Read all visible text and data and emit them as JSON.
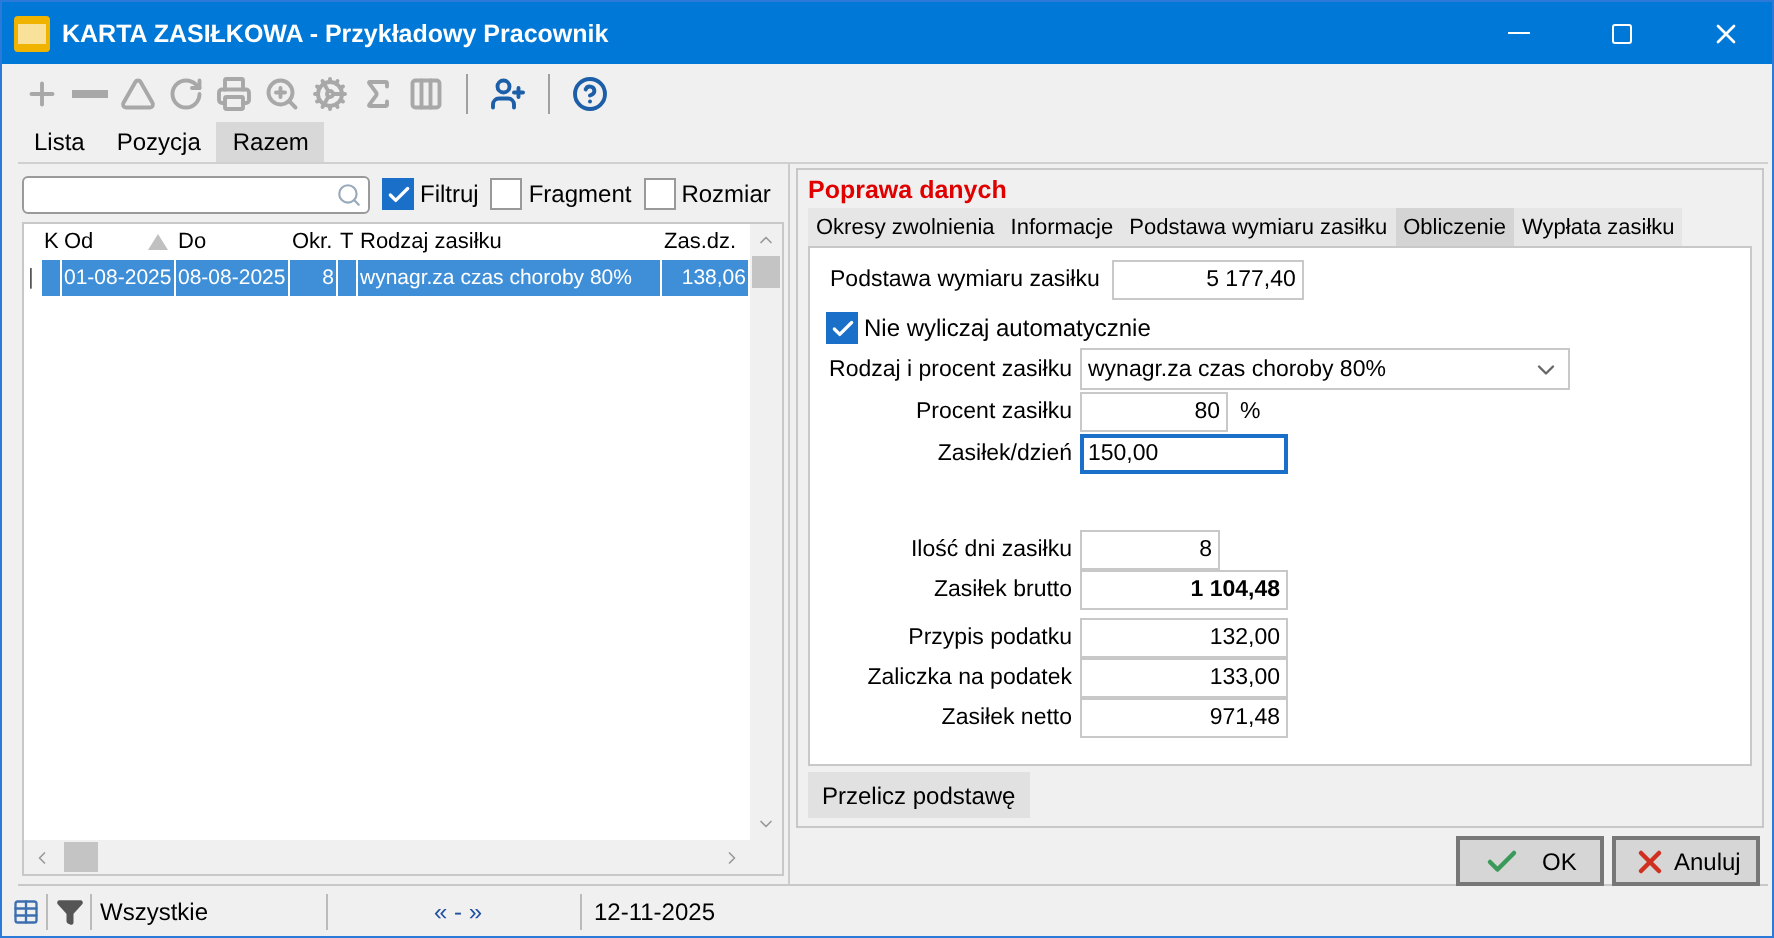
{
  "window": {
    "title": "KARTA ZASIŁKOWA - Przykładowy Pracownik"
  },
  "toolbar": [
    {
      "kind": "add",
      "disabled": true
    },
    {
      "kind": "remove",
      "disabled": true
    },
    {
      "kind": "triangle",
      "disabled": true
    },
    {
      "kind": "refresh",
      "disabled": true
    },
    {
      "kind": "print",
      "disabled": true
    },
    {
      "kind": "find",
      "disabled": true
    },
    {
      "kind": "gears",
      "disabled": true
    },
    {
      "kind": "sum",
      "disabled": true
    },
    {
      "kind": "columns",
      "disabled": true
    },
    {
      "kind": "separator"
    },
    {
      "kind": "user-add",
      "disabled": false
    },
    {
      "kind": "separator"
    },
    {
      "kind": "help",
      "disabled": false
    }
  ],
  "view_tabs": [
    {
      "label": "Lista",
      "selected": false
    },
    {
      "label": "Pozycja",
      "selected": false
    },
    {
      "label": "Razem",
      "selected": true
    }
  ],
  "filter_options": [
    {
      "label": "Filtruj",
      "checked": true
    },
    {
      "label": "Fragment",
      "checked": false
    },
    {
      "label": "Rozmiar",
      "checked": false
    }
  ],
  "table": {
    "columns": [
      {
        "label": "K",
        "sorted": false
      },
      {
        "label": "Od",
        "sorted": true
      },
      {
        "label": "Do",
        "sorted": false
      },
      {
        "label": "Okr.",
        "sorted": false
      },
      {
        "label": "T",
        "sorted": false
      },
      {
        "label": "Rodzaj zasiłku",
        "sorted": false
      },
      {
        "label": "Zas.dz.",
        "sorted": false
      }
    ],
    "rows": [
      {
        "selected": true,
        "marker": "|",
        "cells": [
          "",
          "01-08-2025",
          "08-08-2025",
          "8",
          "",
          "wynagr.za czas choroby 80%",
          "138,06"
        ]
      }
    ]
  },
  "panel": {
    "title": "Poprawa danych",
    "tabs": [
      {
        "label": "Okresy zwolnienia",
        "selected": false
      },
      {
        "label": "Informacje",
        "selected": false
      },
      {
        "label": "Podstawa wymiaru zasiłku",
        "selected": false
      },
      {
        "label": "Obliczenie",
        "selected": true
      },
      {
        "label": "Wypłata zasiłku",
        "selected": false
      }
    ],
    "base": {
      "label": "Podstawa wymiaru zasiłku",
      "value": "5 177,40"
    },
    "auto_option": {
      "label": "Nie wyliczaj automatycznie",
      "checked": true
    },
    "groups": [
      [
        {
          "kind": "select",
          "label": "Rodzaj i procent zasiłku",
          "value": "wynagr.za czas choroby 80%"
        },
        {
          "kind": "percent",
          "label": "Procent zasiłku",
          "value": "80",
          "unit": "%"
        },
        {
          "kind": "edit",
          "label": "Zasiłek/dzień",
          "value": "150,00",
          "focused": true
        }
      ],
      [
        {
          "kind": "count",
          "label": "Ilość dni zasiłku",
          "value": "8"
        },
        {
          "kind": "amount",
          "label": "Zasiłek brutto",
          "value": "1 104,48",
          "bold": true
        }
      ],
      [
        {
          "kind": "amount",
          "label": "Przypis podatku",
          "value": "132,00",
          "bold": false
        },
        {
          "kind": "amount",
          "label": "Zaliczka na podatek",
          "value": "133,00",
          "bold": false
        },
        {
          "kind": "amount",
          "label": "Zasiłek netto",
          "value": "971,48",
          "bold": false
        }
      ]
    ],
    "recalc_button": "Przelicz podstawę"
  },
  "dialog_buttons": [
    {
      "kind": "ok",
      "label": "OK"
    },
    {
      "kind": "cancel",
      "label": "Anuluj"
    }
  ],
  "status_bar": {
    "filter": "Wszystkie",
    "navigation": "« - »",
    "date": "12-11-2025"
  }
}
